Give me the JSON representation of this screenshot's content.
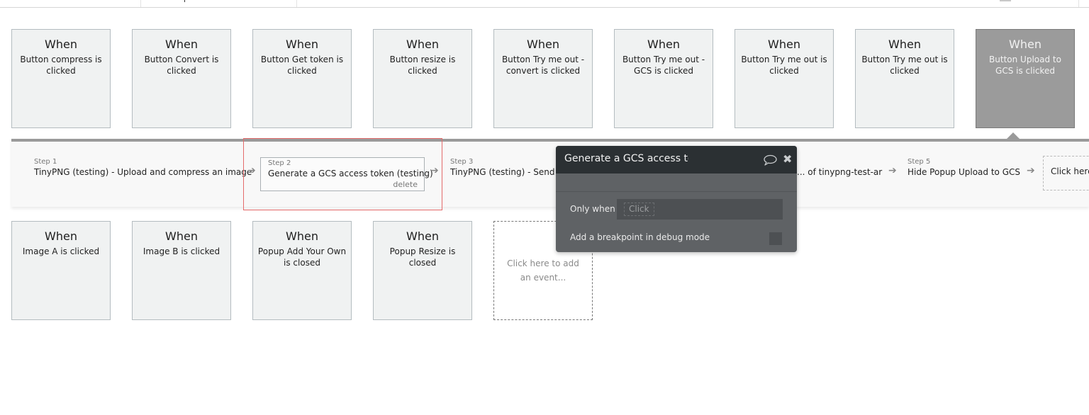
{
  "events_row_1": [
    {
      "label": "When",
      "desc": "Button compress is clicked"
    },
    {
      "label": "When",
      "desc": "Button Convert is clicked"
    },
    {
      "label": "When",
      "desc": "Button Get token is clicked"
    },
    {
      "label": "When",
      "desc": "Button resize is clicked"
    },
    {
      "label": "When",
      "desc": "Button Try me out - convert is clicked"
    },
    {
      "label": "When",
      "desc": "Button Try me out - GCS is clicked"
    },
    {
      "label": "When",
      "desc": "Button Try me out is clicked"
    },
    {
      "label": "When",
      "desc": "Button Try me out is clicked"
    },
    {
      "label": "When",
      "desc": "Button Upload to GCS is clicked",
      "selected": true
    }
  ],
  "events_row_2": [
    {
      "label": "When",
      "desc": "Image A is clicked"
    },
    {
      "label": "When",
      "desc": "Image B is clicked"
    },
    {
      "label": "When",
      "desc": "Popup Add Your Own is closed"
    },
    {
      "label": "When",
      "desc": "Popup Resize is closed"
    }
  ],
  "add_event_label": "Click here to add an event...",
  "workflow": {
    "steps": [
      {
        "num": "Step 1",
        "title": "TinyPNG (testing) - Upload and compress an image"
      },
      {
        "num": "Step 2",
        "title": "Generate a GCS access token (testing)",
        "delete": "delete"
      },
      {
        "num": "Step 3",
        "title": "TinyPNG (testing) - Send a"
      },
      {
        "num": "",
        "title": "... of tinypng-test-ar"
      },
      {
        "num": "Step 5",
        "title": "Hide Popup Upload to GCS"
      }
    ],
    "add_step_label": "Click here"
  },
  "editor": {
    "title": "Generate a GCS access tol",
    "only_when_label": "Only when",
    "only_when_placeholder": "Click",
    "breakpoint_label": "Add a breakpoint in debug mode",
    "breakpoint_checked": false
  },
  "colors": {
    "selected_card": "#9b9b9b",
    "highlight_border": "#e46b6b",
    "editor_header": "#2b3033",
    "editor_body": "#5f6265"
  }
}
